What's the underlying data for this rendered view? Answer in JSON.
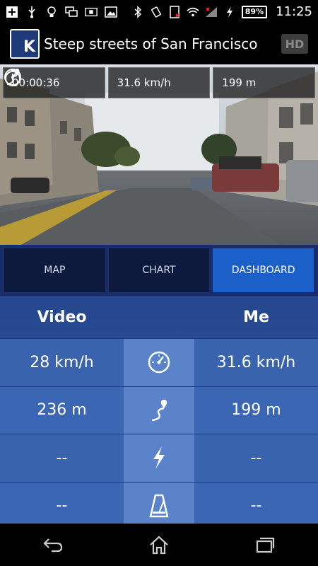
{
  "status_bar": {
    "battery": "89%",
    "time": "11:25"
  },
  "app_bar": {
    "logo_letter": "K",
    "title": "Steep streets of San Francisco",
    "hd_label": "HD"
  },
  "overlay_stats": {
    "duration": "00:00:36",
    "speed": "31.6 km/h",
    "distance": "199 m"
  },
  "tabs": [
    {
      "label": "MAP",
      "active": false
    },
    {
      "label": "CHART",
      "active": false
    },
    {
      "label": "DASHBOARD",
      "active": true
    }
  ],
  "dashboard": {
    "left_header": "Video",
    "right_header": "Me",
    "rows": [
      {
        "icon": "speedometer-icon",
        "video": "28 km/h",
        "me": "31.6 km/h"
      },
      {
        "icon": "distance-icon",
        "video": "236 m",
        "me": "199 m"
      },
      {
        "icon": "power-icon",
        "video": "--",
        "me": "--"
      },
      {
        "icon": "metronome-icon",
        "video": "--",
        "me": "--"
      }
    ]
  },
  "colors": {
    "accent": "#1b5fc8",
    "tab_bg": "#0d1a3d",
    "dashboard_bg": "#2c56a6"
  }
}
